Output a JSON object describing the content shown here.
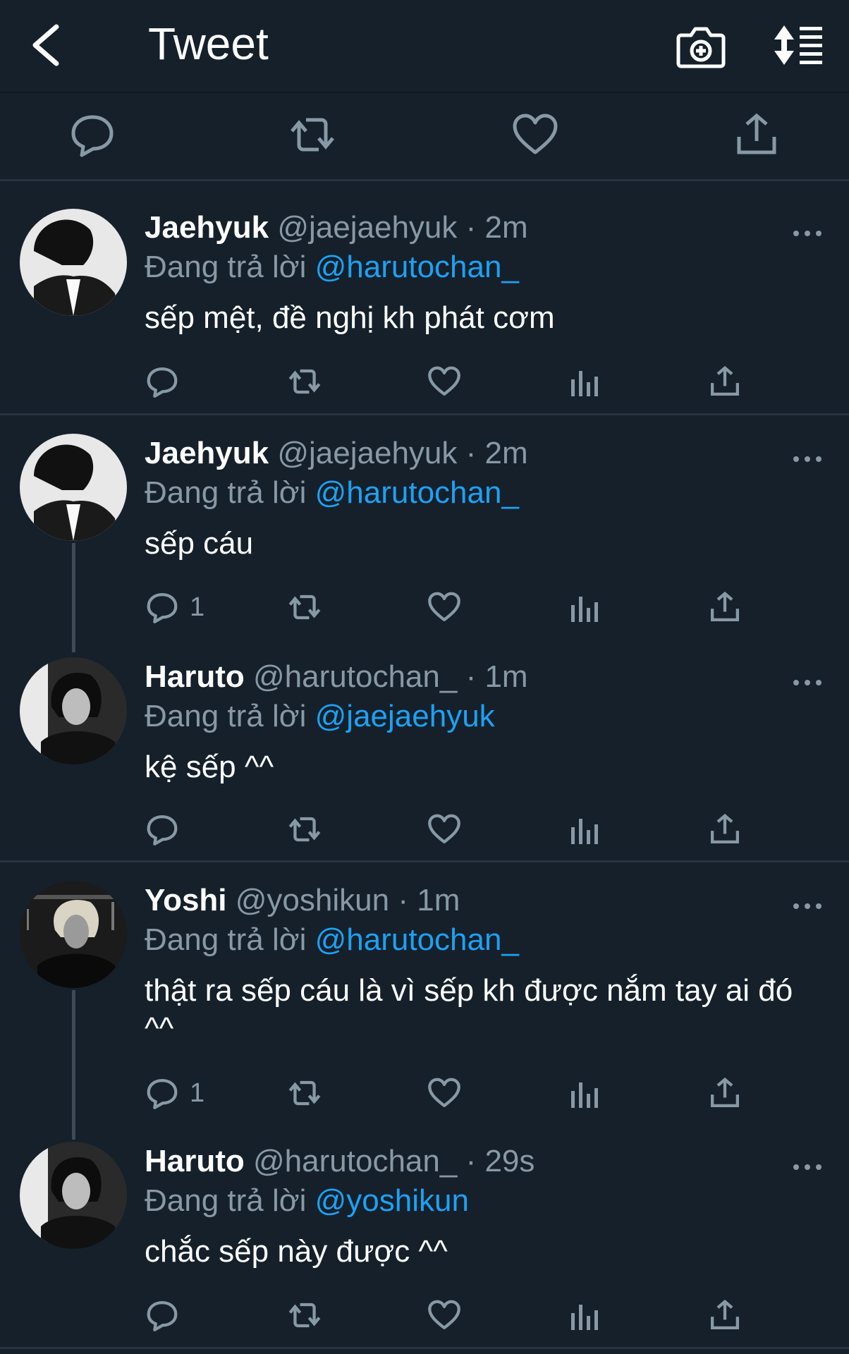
{
  "header": {
    "title": "Tweet"
  },
  "replying_label": "Đang trả lời",
  "tweets": [
    {
      "name": "Jaehyuk",
      "handle": "@jaejaehyuk",
      "time": "2m",
      "reply_to": "@harutochan_",
      "text": "sếp mệt, đề nghị kh phát cơm",
      "reply_count": ""
    },
    {
      "name": "Jaehyuk",
      "handle": "@jaejaehyuk",
      "time": "2m",
      "reply_to": "@harutochan_",
      "text": "sếp cáu",
      "reply_count": "1"
    },
    {
      "name": "Haruto",
      "handle": "@harutochan_",
      "time": "1m",
      "reply_to": "@jaejaehyuk",
      "text": "kệ sếp ^^",
      "reply_count": ""
    },
    {
      "name": "Yoshi",
      "handle": "@yoshikun",
      "time": "1m",
      "reply_to": "@harutochan_",
      "text": "thật ra sếp cáu là vì sếp kh được nắm tay ai đó ^^",
      "reply_count": "1"
    },
    {
      "name": "Haruto",
      "handle": "@harutochan_",
      "time": "29s",
      "reply_to": "@yoshikun",
      "text": "chắc sếp này được ^^",
      "reply_count": ""
    }
  ],
  "colors": {
    "background": "#15202b",
    "secondary_text": "#8899a6",
    "mention": "#1da1f2",
    "divider": "#273340"
  }
}
